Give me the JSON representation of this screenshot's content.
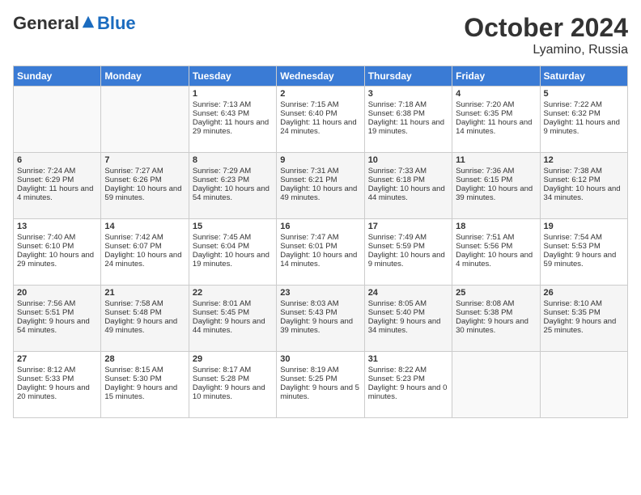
{
  "header": {
    "logo_general": "General",
    "logo_blue": "Blue",
    "month": "October 2024",
    "location": "Lyamino, Russia"
  },
  "days_of_week": [
    "Sunday",
    "Monday",
    "Tuesday",
    "Wednesday",
    "Thursday",
    "Friday",
    "Saturday"
  ],
  "weeks": [
    [
      {
        "day": "",
        "content": ""
      },
      {
        "day": "",
        "content": ""
      },
      {
        "day": "1",
        "content": "Sunrise: 7:13 AM\nSunset: 6:43 PM\nDaylight: 11 hours and 29 minutes."
      },
      {
        "day": "2",
        "content": "Sunrise: 7:15 AM\nSunset: 6:40 PM\nDaylight: 11 hours and 24 minutes."
      },
      {
        "day": "3",
        "content": "Sunrise: 7:18 AM\nSunset: 6:38 PM\nDaylight: 11 hours and 19 minutes."
      },
      {
        "day": "4",
        "content": "Sunrise: 7:20 AM\nSunset: 6:35 PM\nDaylight: 11 hours and 14 minutes."
      },
      {
        "day": "5",
        "content": "Sunrise: 7:22 AM\nSunset: 6:32 PM\nDaylight: 11 hours and 9 minutes."
      }
    ],
    [
      {
        "day": "6",
        "content": "Sunrise: 7:24 AM\nSunset: 6:29 PM\nDaylight: 11 hours and 4 minutes."
      },
      {
        "day": "7",
        "content": "Sunrise: 7:27 AM\nSunset: 6:26 PM\nDaylight: 10 hours and 59 minutes."
      },
      {
        "day": "8",
        "content": "Sunrise: 7:29 AM\nSunset: 6:23 PM\nDaylight: 10 hours and 54 minutes."
      },
      {
        "day": "9",
        "content": "Sunrise: 7:31 AM\nSunset: 6:21 PM\nDaylight: 10 hours and 49 minutes."
      },
      {
        "day": "10",
        "content": "Sunrise: 7:33 AM\nSunset: 6:18 PM\nDaylight: 10 hours and 44 minutes."
      },
      {
        "day": "11",
        "content": "Sunrise: 7:36 AM\nSunset: 6:15 PM\nDaylight: 10 hours and 39 minutes."
      },
      {
        "day": "12",
        "content": "Sunrise: 7:38 AM\nSunset: 6:12 PM\nDaylight: 10 hours and 34 minutes."
      }
    ],
    [
      {
        "day": "13",
        "content": "Sunrise: 7:40 AM\nSunset: 6:10 PM\nDaylight: 10 hours and 29 minutes."
      },
      {
        "day": "14",
        "content": "Sunrise: 7:42 AM\nSunset: 6:07 PM\nDaylight: 10 hours and 24 minutes."
      },
      {
        "day": "15",
        "content": "Sunrise: 7:45 AM\nSunset: 6:04 PM\nDaylight: 10 hours and 19 minutes."
      },
      {
        "day": "16",
        "content": "Sunrise: 7:47 AM\nSunset: 6:01 PM\nDaylight: 10 hours and 14 minutes."
      },
      {
        "day": "17",
        "content": "Sunrise: 7:49 AM\nSunset: 5:59 PM\nDaylight: 10 hours and 9 minutes."
      },
      {
        "day": "18",
        "content": "Sunrise: 7:51 AM\nSunset: 5:56 PM\nDaylight: 10 hours and 4 minutes."
      },
      {
        "day": "19",
        "content": "Sunrise: 7:54 AM\nSunset: 5:53 PM\nDaylight: 9 hours and 59 minutes."
      }
    ],
    [
      {
        "day": "20",
        "content": "Sunrise: 7:56 AM\nSunset: 5:51 PM\nDaylight: 9 hours and 54 minutes."
      },
      {
        "day": "21",
        "content": "Sunrise: 7:58 AM\nSunset: 5:48 PM\nDaylight: 9 hours and 49 minutes."
      },
      {
        "day": "22",
        "content": "Sunrise: 8:01 AM\nSunset: 5:45 PM\nDaylight: 9 hours and 44 minutes."
      },
      {
        "day": "23",
        "content": "Sunrise: 8:03 AM\nSunset: 5:43 PM\nDaylight: 9 hours and 39 minutes."
      },
      {
        "day": "24",
        "content": "Sunrise: 8:05 AM\nSunset: 5:40 PM\nDaylight: 9 hours and 34 minutes."
      },
      {
        "day": "25",
        "content": "Sunrise: 8:08 AM\nSunset: 5:38 PM\nDaylight: 9 hours and 30 minutes."
      },
      {
        "day": "26",
        "content": "Sunrise: 8:10 AM\nSunset: 5:35 PM\nDaylight: 9 hours and 25 minutes."
      }
    ],
    [
      {
        "day": "27",
        "content": "Sunrise: 8:12 AM\nSunset: 5:33 PM\nDaylight: 9 hours and 20 minutes."
      },
      {
        "day": "28",
        "content": "Sunrise: 8:15 AM\nSunset: 5:30 PM\nDaylight: 9 hours and 15 minutes."
      },
      {
        "day": "29",
        "content": "Sunrise: 8:17 AM\nSunset: 5:28 PM\nDaylight: 9 hours and 10 minutes."
      },
      {
        "day": "30",
        "content": "Sunrise: 8:19 AM\nSunset: 5:25 PM\nDaylight: 9 hours and 5 minutes."
      },
      {
        "day": "31",
        "content": "Sunrise: 8:22 AM\nSunset: 5:23 PM\nDaylight: 9 hours and 0 minutes."
      },
      {
        "day": "",
        "content": ""
      },
      {
        "day": "",
        "content": ""
      }
    ]
  ]
}
